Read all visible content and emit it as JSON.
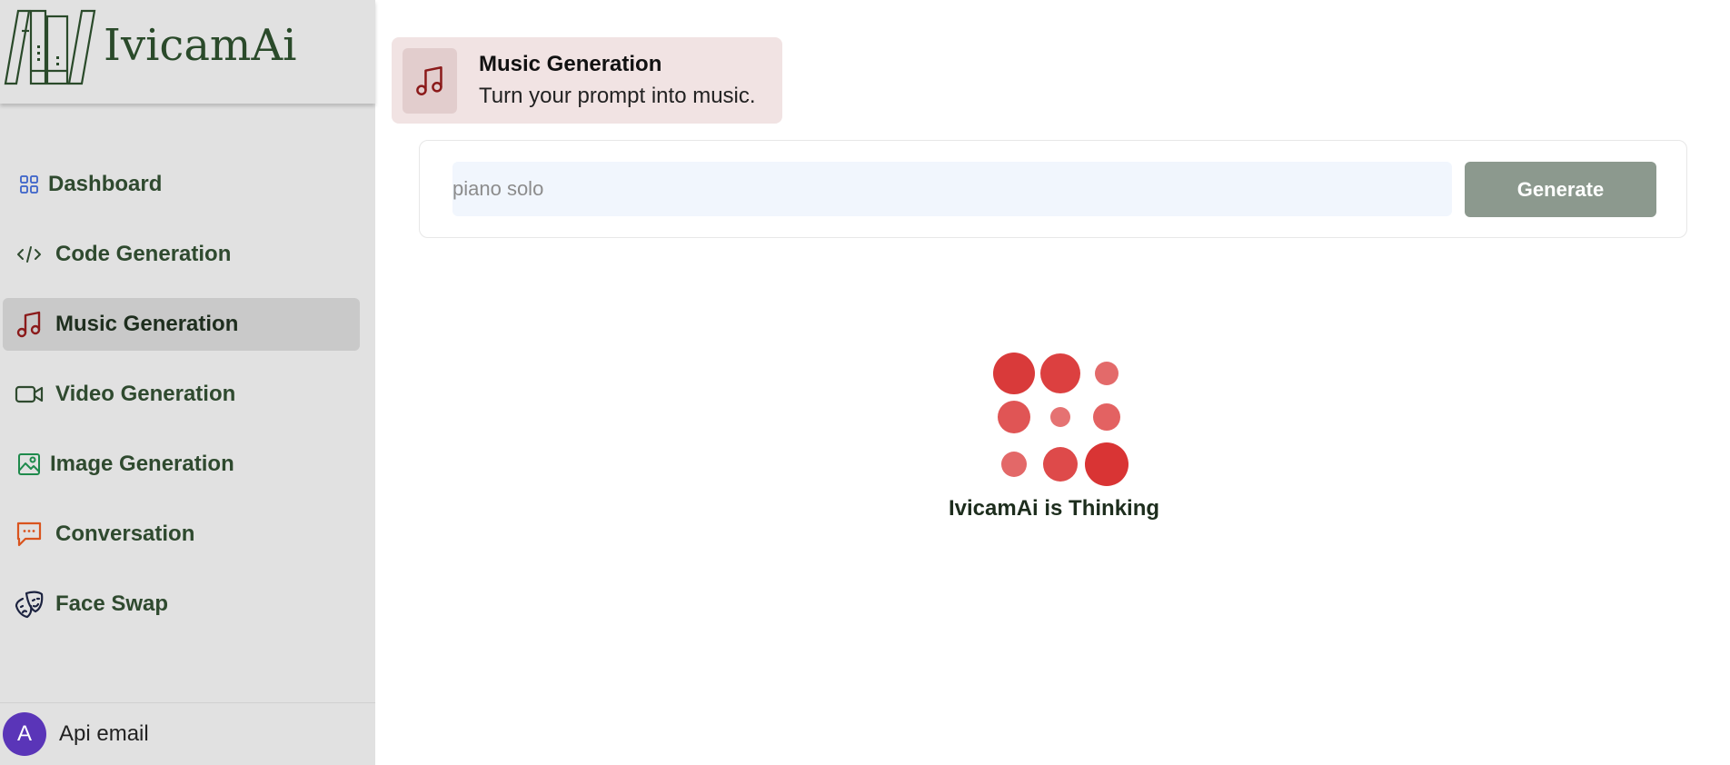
{
  "app": {
    "name": "IvicamAi"
  },
  "sidebar": {
    "items": [
      {
        "label": "Dashboard",
        "icon": "grid-icon",
        "color": "#3b62c9"
      },
      {
        "label": "Code Generation",
        "icon": "code-icon",
        "color": "#2f4a2f"
      },
      {
        "label": "Music Generation",
        "icon": "music-note-icon",
        "color": "#8b1a1a",
        "active": true
      },
      {
        "label": "Video Generation",
        "icon": "video-camera-icon",
        "color": "#2f4a2f"
      },
      {
        "label": "Image Generation",
        "icon": "image-icon",
        "color": "#1f8a4c"
      },
      {
        "label": "Conversation",
        "icon": "chat-bubble-icon",
        "color": "#d9541e"
      },
      {
        "label": "Face Swap",
        "icon": "theater-masks-icon",
        "color": "#1c2340"
      }
    ],
    "user": {
      "avatar_letter": "A",
      "label": "Api email",
      "avatar_color": "#5a35b8"
    }
  },
  "header": {
    "title": "Music Generation",
    "subtitle": "Turn your prompt into music.",
    "icon": "music-note-icon",
    "accent": "#8b1a1a"
  },
  "form": {
    "placeholder": "piano solo",
    "value": "",
    "button_label": "Generate"
  },
  "loader": {
    "status_text": "IvicamAi is Thinking",
    "color": "#d93a3a"
  }
}
